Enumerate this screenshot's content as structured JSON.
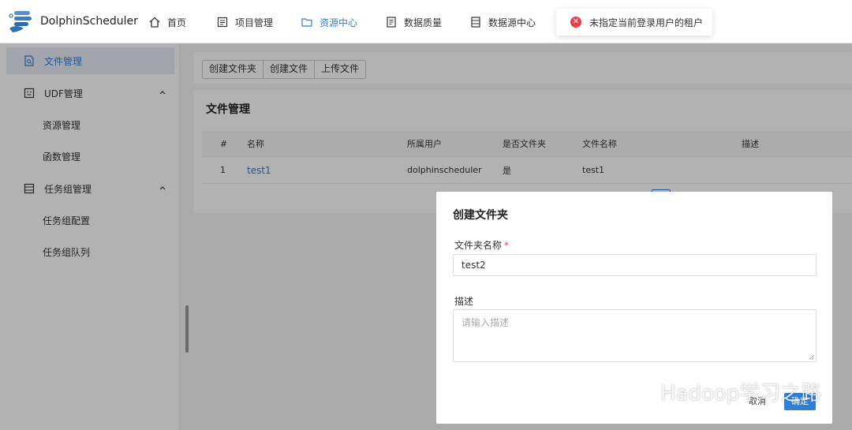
{
  "app": {
    "logo_text": "DolphinScheduler"
  },
  "nav": {
    "items": [
      {
        "label": "首页",
        "icon": "home-icon"
      },
      {
        "label": "项目管理",
        "icon": "project-icon"
      },
      {
        "label": "资源中心",
        "icon": "folder-icon",
        "active": true
      },
      {
        "label": "数据质量",
        "icon": "quality-icon"
      },
      {
        "label": "数据源中心",
        "icon": "datasource-icon"
      }
    ]
  },
  "toast": {
    "message": "未指定当前登录用户的租户",
    "type": "error",
    "color": "#e8404a"
  },
  "sidebar": {
    "items": [
      {
        "label": "文件管理",
        "icon": "file-search-icon",
        "active": true
      },
      {
        "label": "UDF管理",
        "icon": "udf-icon",
        "expanded": true
      },
      {
        "label": "资源管理",
        "sub": true
      },
      {
        "label": "函数管理",
        "sub": true
      },
      {
        "label": "任务组管理",
        "icon": "taskgroup-icon",
        "expanded": true
      },
      {
        "label": "任务组配置",
        "sub": true
      },
      {
        "label": "任务组队列",
        "sub": true
      }
    ]
  },
  "toolbar": {
    "buttons": [
      "创建文件夹",
      "创建文件",
      "上传文件"
    ]
  },
  "card": {
    "title": "文件管理",
    "columns": [
      "#",
      "名称",
      "所属用户",
      "是否文件夹",
      "文件名称",
      "描述"
    ],
    "rows": [
      {
        "index": "1",
        "name": "test1",
        "user": "dolphinscheduler",
        "is_folder": "是",
        "file_name": "test1",
        "desc": ""
      }
    ]
  },
  "modal": {
    "title": "创建文件夹",
    "name_label": "文件夹名称",
    "required_mark": "*",
    "name_value": "test2",
    "desc_label": "描述",
    "desc_placeholder": "请输入描述",
    "cancel_label": "取消",
    "ok_label": "确定"
  },
  "watermark": {
    "text": "Hadoop学习之路"
  },
  "colors": {
    "accent": "#2d7fd8",
    "error": "#e8404a"
  }
}
